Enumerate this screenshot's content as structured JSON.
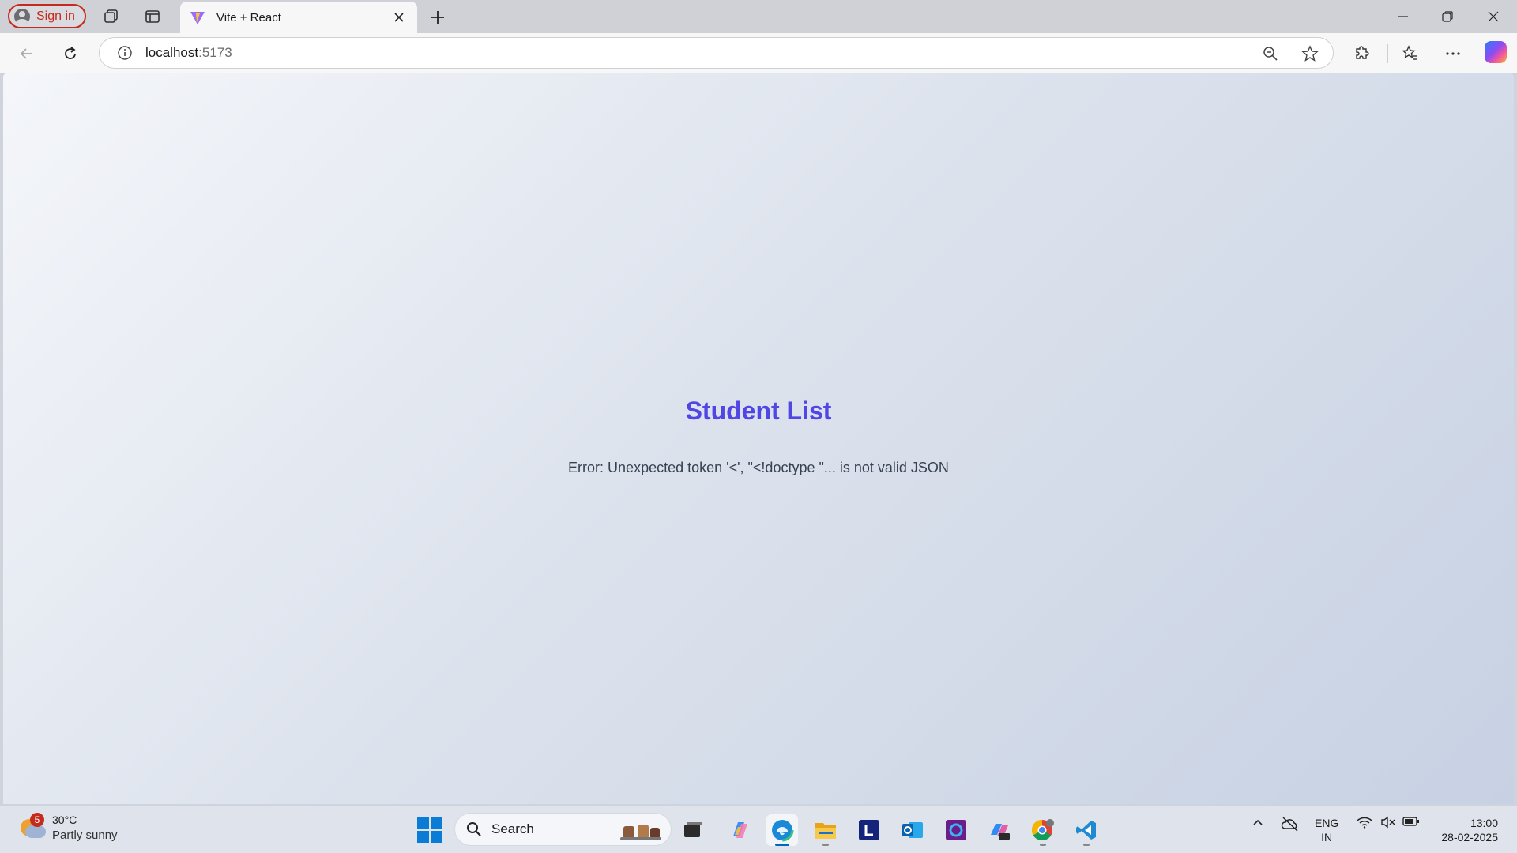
{
  "browser": {
    "sign_in_label": "Sign in",
    "tab_title": "Vite + React",
    "url_host": "localhost",
    "url_port": ":5173"
  },
  "page": {
    "title": "Student List",
    "error": "Error: Unexpected token '<', \"<!doctype \"... is not valid JSON"
  },
  "taskbar": {
    "weather_temp": "30°C",
    "weather_desc": "Partly sunny",
    "weather_badge": "5",
    "search_label": "Search",
    "lang_line1": "ENG",
    "lang_line2": "IN",
    "time": "13:00",
    "date": "28-02-2025",
    "apps": [
      "file-explorer",
      "copilot",
      "edge",
      "folders",
      "l-app",
      "outlook",
      "cortana",
      "m365",
      "chrome",
      "vscode"
    ]
  },
  "colors": {
    "accent": "#4f46e5",
    "error_text": "#374151",
    "signin_red": "#c42b1c"
  }
}
